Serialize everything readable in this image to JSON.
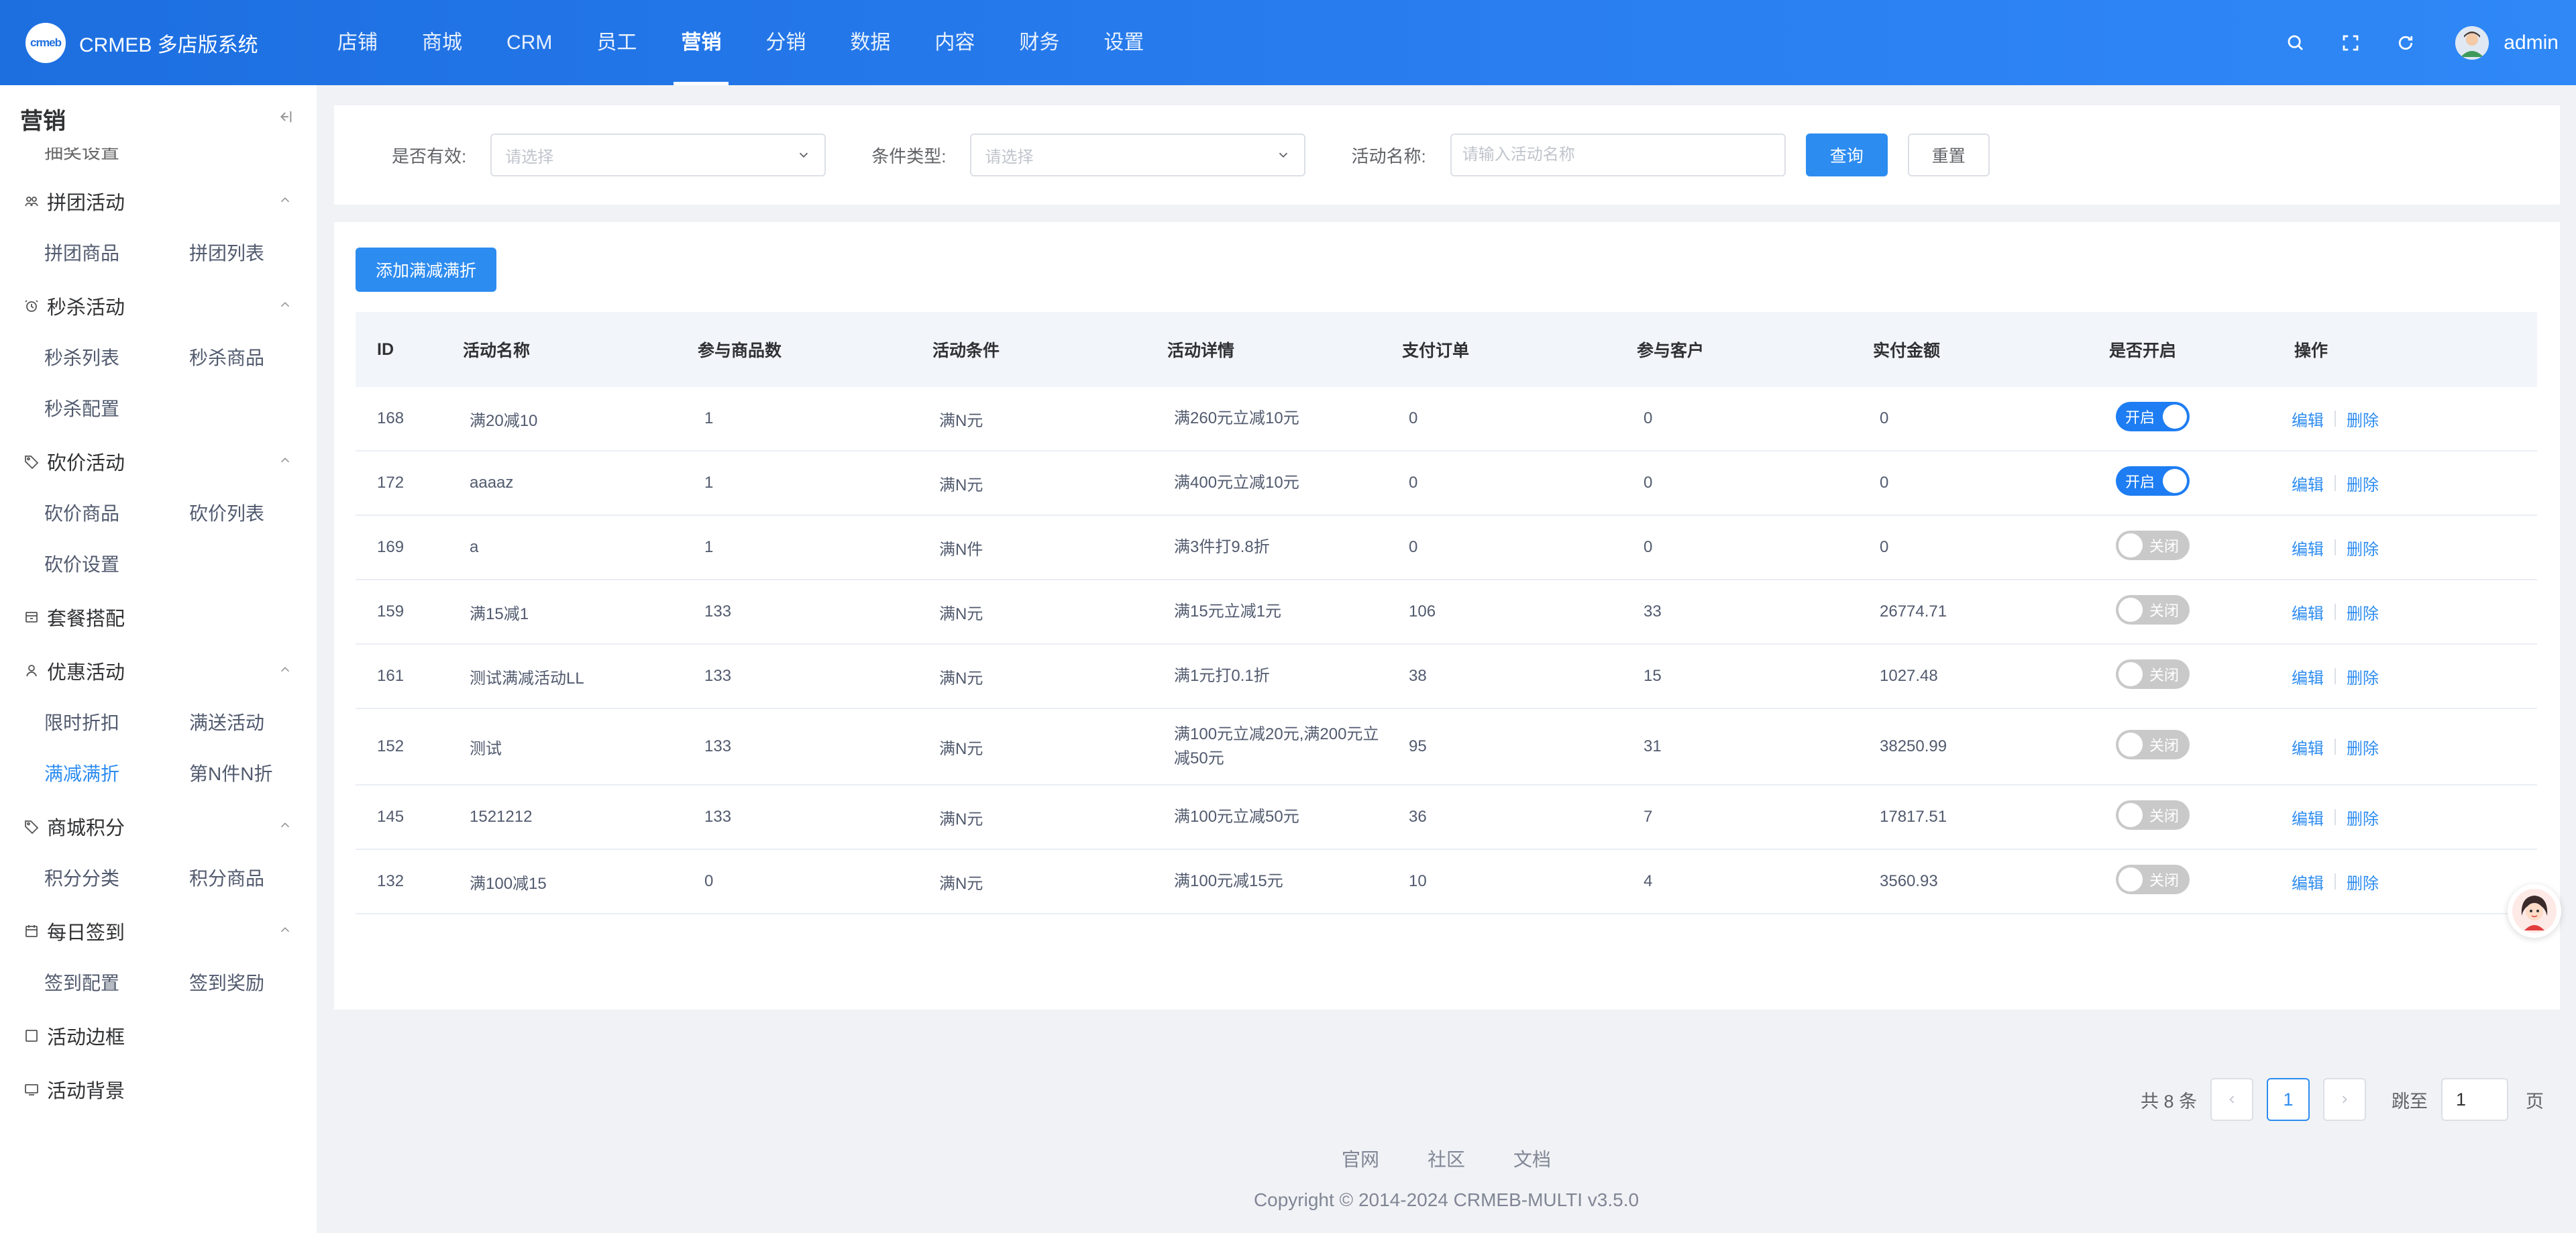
{
  "header": {
    "logo_text": "crmeb",
    "app_title": "CRMEB 多店版系统",
    "nav": [
      {
        "label": "店铺"
      },
      {
        "label": "商城"
      },
      {
        "label": "CRM"
      },
      {
        "label": "员工"
      },
      {
        "label": "营销"
      },
      {
        "label": "分销"
      },
      {
        "label": "数据"
      },
      {
        "label": "内容"
      },
      {
        "label": "财务"
      },
      {
        "label": "设置"
      }
    ],
    "active_nav": "营销",
    "username": "admin"
  },
  "sidebar": {
    "title": "营销",
    "partial_item": "抽奖设置",
    "groups": [
      {
        "label": "拼团活动",
        "icon": "group-buy-icon",
        "items": [
          "拼团商品",
          "拼团列表"
        ]
      },
      {
        "label": "秒杀活动",
        "icon": "clock-icon",
        "items": [
          "秒杀列表",
          "秒杀商品",
          "秒杀配置"
        ]
      },
      {
        "label": "砍价活动",
        "icon": "tag-icon",
        "items": [
          "砍价商品",
          "砍价列表",
          "砍价设置"
        ]
      },
      {
        "label": "套餐搭配",
        "icon": "package-icon",
        "items": []
      },
      {
        "label": "优惠活动",
        "icon": "discount-icon",
        "items": [
          "限时折扣",
          "满送活动",
          "满减满折",
          "第N件N折"
        ]
      },
      {
        "label": "商城积分",
        "icon": "points-icon",
        "items": [
          "积分分类",
          "积分商品"
        ]
      },
      {
        "label": "每日签到",
        "icon": "calendar-icon",
        "items": [
          "签到配置",
          "签到奖励"
        ]
      },
      {
        "label": "活动边框",
        "icon": "frame-icon",
        "items": []
      },
      {
        "label": "活动背景",
        "icon": "background-icon",
        "items": []
      }
    ],
    "active_item": "满减满折"
  },
  "filters": {
    "valid_label": "是否有效:",
    "valid_placeholder": "请选择",
    "type_label": "条件类型:",
    "type_placeholder": "请选择",
    "name_label": "活动名称:",
    "name_placeholder": "请输入活动名称",
    "search_button": "查询",
    "reset_button": "重置"
  },
  "add_button": "添加满减满折",
  "table": {
    "headers": [
      "ID",
      "活动名称",
      "参与商品数",
      "活动条件",
      "活动详情",
      "支付订单",
      "参与客户",
      "实付金额",
      "是否开启",
      "操作"
    ],
    "rows": [
      {
        "id": "168",
        "name": "满20减10",
        "goods": "1",
        "condition": "满N元",
        "detail": "满260元立减10元",
        "orders": "0",
        "customers": "0",
        "amount": "0",
        "enabled": true,
        "switch_text": "开启"
      },
      {
        "id": "172",
        "name": "aaaaz",
        "goods": "1",
        "condition": "满N元",
        "detail": "满400元立减10元",
        "orders": "0",
        "customers": "0",
        "amount": "0",
        "enabled": true,
        "switch_text": "开启"
      },
      {
        "id": "169",
        "name": "a",
        "goods": "1",
        "condition": "满N件",
        "detail": "满3件打9.8折",
        "orders": "0",
        "customers": "0",
        "amount": "0",
        "enabled": false,
        "switch_text": "关闭"
      },
      {
        "id": "159",
        "name": "满15减1",
        "goods": "133",
        "condition": "满N元",
        "detail": "满15元立减1元",
        "orders": "106",
        "customers": "33",
        "amount": "26774.71",
        "enabled": false,
        "switch_text": "关闭"
      },
      {
        "id": "161",
        "name": "测试满减活动LL",
        "goods": "133",
        "condition": "满N元",
        "detail": "满1元打0.1折",
        "orders": "38",
        "customers": "15",
        "amount": "1027.48",
        "enabled": false,
        "switch_text": "关闭"
      },
      {
        "id": "152",
        "name": "测试",
        "goods": "133",
        "condition": "满N元",
        "detail": "满100元立减20元,满200元立减50元",
        "orders": "95",
        "customers": "31",
        "amount": "38250.99",
        "enabled": false,
        "switch_text": "关闭"
      },
      {
        "id": "145",
        "name": "1521212",
        "goods": "133",
        "condition": "满N元",
        "detail": "满100元立减50元",
        "orders": "36",
        "customers": "7",
        "amount": "17817.51",
        "enabled": false,
        "switch_text": "关闭"
      },
      {
        "id": "132",
        "name": "满100减15",
        "goods": "0",
        "condition": "满N元",
        "detail": "满100元减15元",
        "orders": "10",
        "customers": "4",
        "amount": "3560.93",
        "enabled": false,
        "switch_text": "关闭"
      }
    ],
    "edit_label": "编辑",
    "delete_label": "删除"
  },
  "pagination": {
    "total_text": "共 8 条",
    "current_page": "1",
    "jump_label": "跳至",
    "jump_value": "1",
    "page_suffix": "页"
  },
  "footer": {
    "links": [
      "官网",
      "社区",
      "文档"
    ],
    "copyright": "Copyright © 2014-2024 CRMEB-MULTI v3.5.0"
  },
  "colors": {
    "primary": "#2d8cf0",
    "header": "#1d6fe0",
    "switch_on": "#1e7df2",
    "switch_off": "#c9c9c9"
  }
}
